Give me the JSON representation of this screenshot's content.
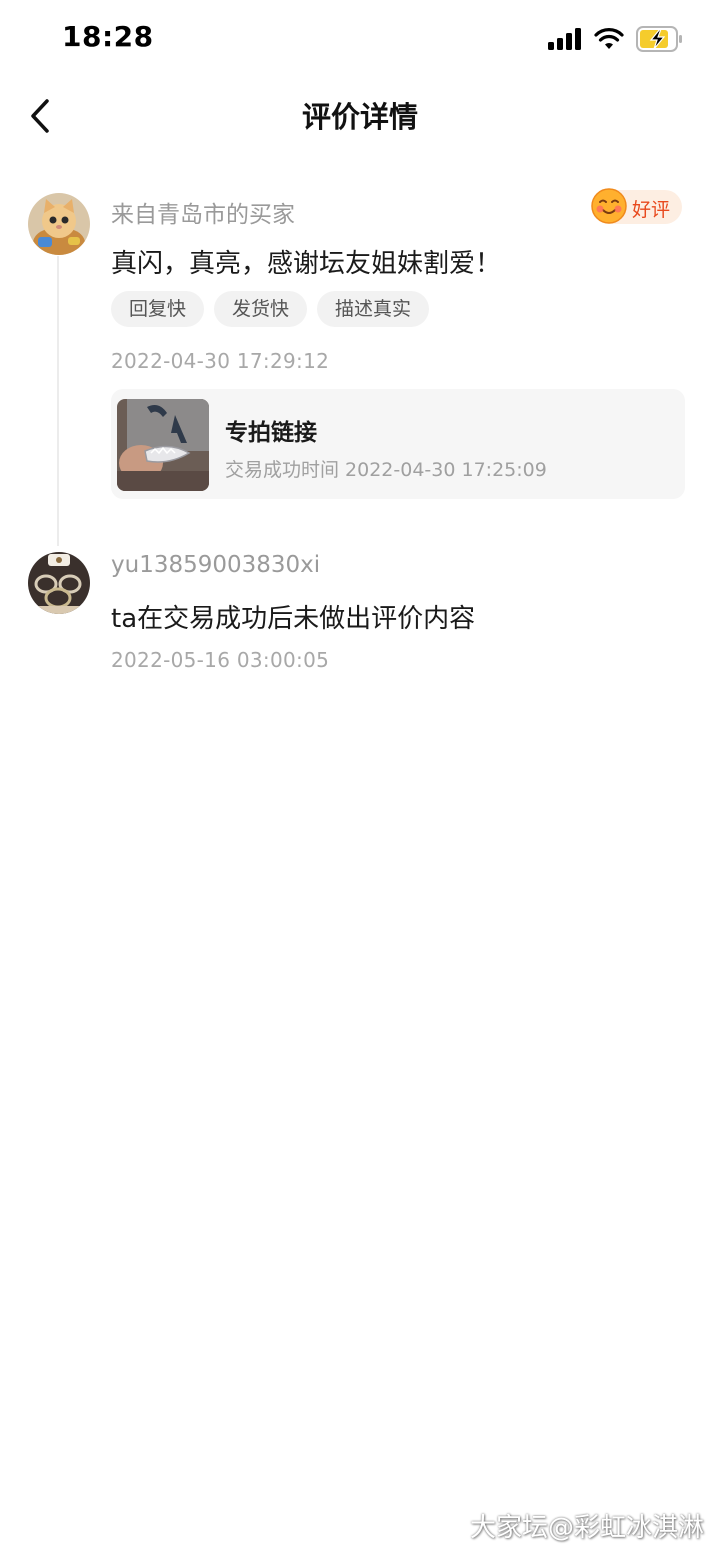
{
  "status_bar": {
    "time": "18:28"
  },
  "nav": {
    "title": "评价详情"
  },
  "reviews": [
    {
      "reviewer": "来自青岛市的买家",
      "rating_label": "好评",
      "text": "真闪，真亮，感谢坛友姐妹割爱！",
      "tags": [
        "回复快",
        "发货快",
        "描述真实"
      ],
      "date": "2022-04-30 17:29:12",
      "product": {
        "title": "专拍链接",
        "deal_time": "交易成功时间 2022-04-30 17:25:09"
      }
    },
    {
      "reviewer": "yu13859003830xi",
      "text": "ta在交易成功后未做出评价内容",
      "date": "2022-05-16 03:00:05"
    }
  ],
  "watermark": "大家坛@彩虹冰淇淋",
  "colors": {
    "badge_bg": "#fdeee2",
    "badge_text": "#e8491d",
    "battery": "#f5cc2c"
  }
}
